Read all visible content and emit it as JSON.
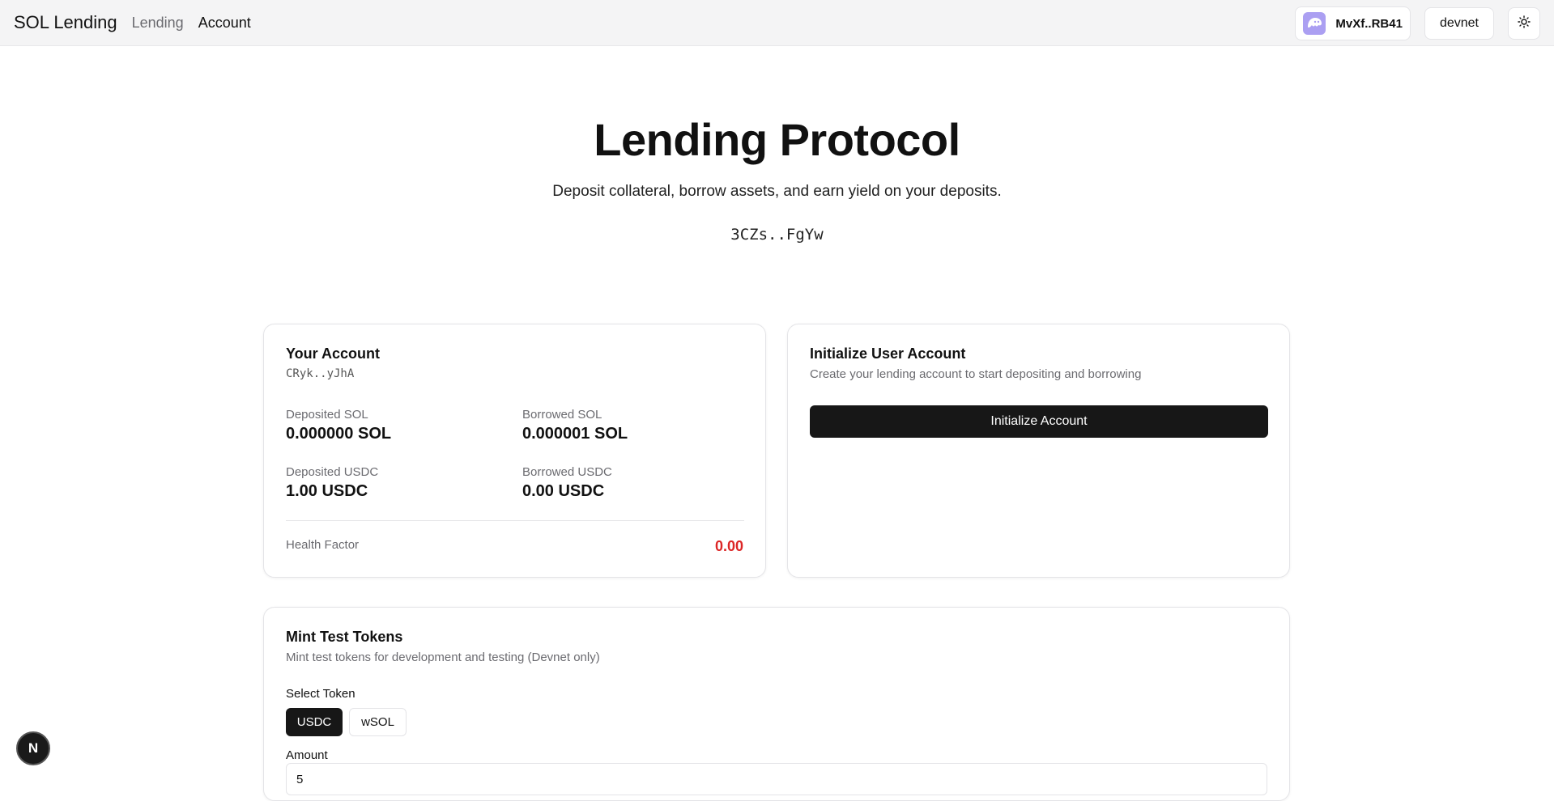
{
  "header": {
    "brand": "SOL Lending",
    "nav": [
      {
        "label": "Lending"
      },
      {
        "label": "Account"
      }
    ],
    "wallet_label": "MvXf..RB41",
    "network_label": "devnet",
    "theme_icon": "sun-icon",
    "wallet_icon": "phantom-icon"
  },
  "hero": {
    "title": "Lending Protocol",
    "subtitle": "Deposit collateral, borrow assets, and earn yield on your deposits.",
    "program_address": "3CZs..FgYw"
  },
  "account_card": {
    "title": "Your Account",
    "address": "CRyk..yJhA",
    "stats": [
      {
        "label": "Deposited SOL",
        "value": "0.000000 SOL"
      },
      {
        "label": "Borrowed SOL",
        "value": "0.000001 SOL"
      },
      {
        "label": "Deposited USDC",
        "value": "1.00 USDC"
      },
      {
        "label": "Borrowed USDC",
        "value": "0.00 USDC"
      }
    ],
    "health_label": "Health Factor",
    "health_value": "0.00",
    "health_color": "#dc2626"
  },
  "init_card": {
    "title": "Initialize User Account",
    "description": "Create your lending account to start depositing and borrowing",
    "button_label": "Initialize Account"
  },
  "mint_card": {
    "title": "Mint Test Tokens",
    "description": "Mint test tokens for development and testing (Devnet only)",
    "select_label": "Select Token",
    "tokens": [
      {
        "label": "USDC",
        "selected": true
      },
      {
        "label": "wSOL",
        "selected": false
      }
    ],
    "amount_label": "Amount",
    "amount_value": "5"
  },
  "dev_badge": {
    "label": "N",
    "icon": "nextjs-icon"
  }
}
